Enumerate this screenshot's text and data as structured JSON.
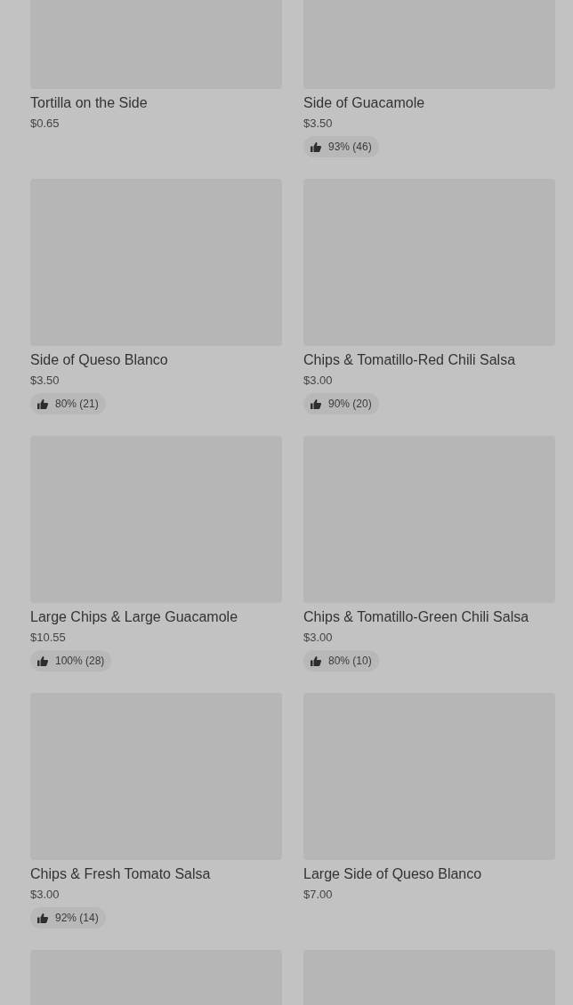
{
  "items": [
    {
      "kind": "dish",
      "name": "Tortilla on the Side",
      "price": "$0.65"
    },
    {
      "kind": "dish",
      "name": "Side of Guacamole",
      "price": "$3.50",
      "rating": "93% (46)"
    },
    {
      "kind": "dish",
      "name": "Side of Queso Blanco",
      "price": "$3.50",
      "rating": "80% (21)"
    },
    {
      "kind": "dish",
      "name": "Chips & Tomatillo-Red Chili Salsa",
      "price": "$3.00",
      "rating": "90% (20)"
    },
    {
      "kind": "dish",
      "name": "Large Chips & Large Guacamole",
      "price": "$10.55",
      "rating": "100% (28)"
    },
    {
      "kind": "dish",
      "name": "Chips & Tomatillo-Green Chili Salsa",
      "price": "$3.00",
      "rating": "80% (10)"
    },
    {
      "kind": "dish",
      "name": "Chips & Fresh Tomato Salsa",
      "price": "$3.00",
      "rating": "92% (14)"
    },
    {
      "kind": "dish",
      "name": "Large Side of Queso Blanco",
      "price": "$7.00"
    },
    {
      "kind": "image_only"
    },
    {
      "kind": "image_only"
    }
  ]
}
